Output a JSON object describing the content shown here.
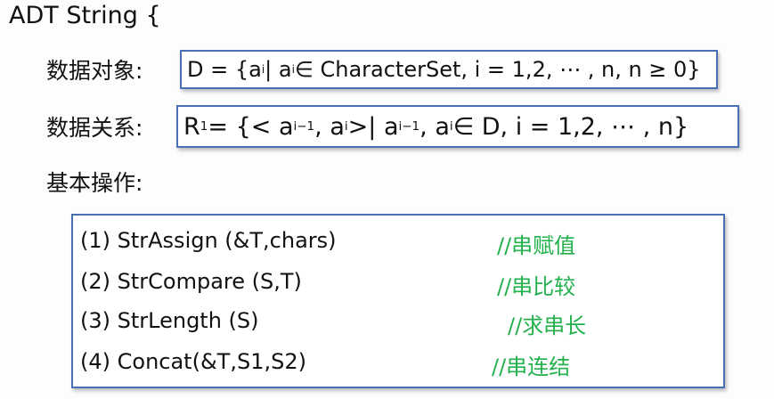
{
  "title": "ADT String {",
  "data_object_label": "数据对象:",
  "data_object_formula": {
    "p1": "D = {a",
    "s1": "i",
    "p2": " | a",
    "s2": "i",
    "p3": " ∈ CharacterSet, i = 1,2, ⋯ , n,  n ≥ 0}"
  },
  "data_relation_label": "数据关系:",
  "data_relation_formula": {
    "p1": "R",
    "s1": "1",
    "p2": " = {< a",
    "s2": "i−1",
    "p3": ", a",
    "s3": "i",
    "p4": " >| a",
    "s4": "i−1",
    "p5": ", a",
    "s5": "i",
    "p6": " ∈ D, i = 1,2, ⋯ , n}"
  },
  "operations_label": "基本操作:",
  "operations": [
    {
      "code": "(1)  StrAssign (&T,chars)",
      "comment": "//串赋值"
    },
    {
      "code": "(2) StrCompare (S,T)",
      "comment": "//串比较"
    },
    {
      "code": "(3) StrLength (S)",
      "comment": "//求串长"
    },
    {
      "code": "(4) Concat(&T,S1,S2)",
      "comment": "//串连结"
    }
  ]
}
